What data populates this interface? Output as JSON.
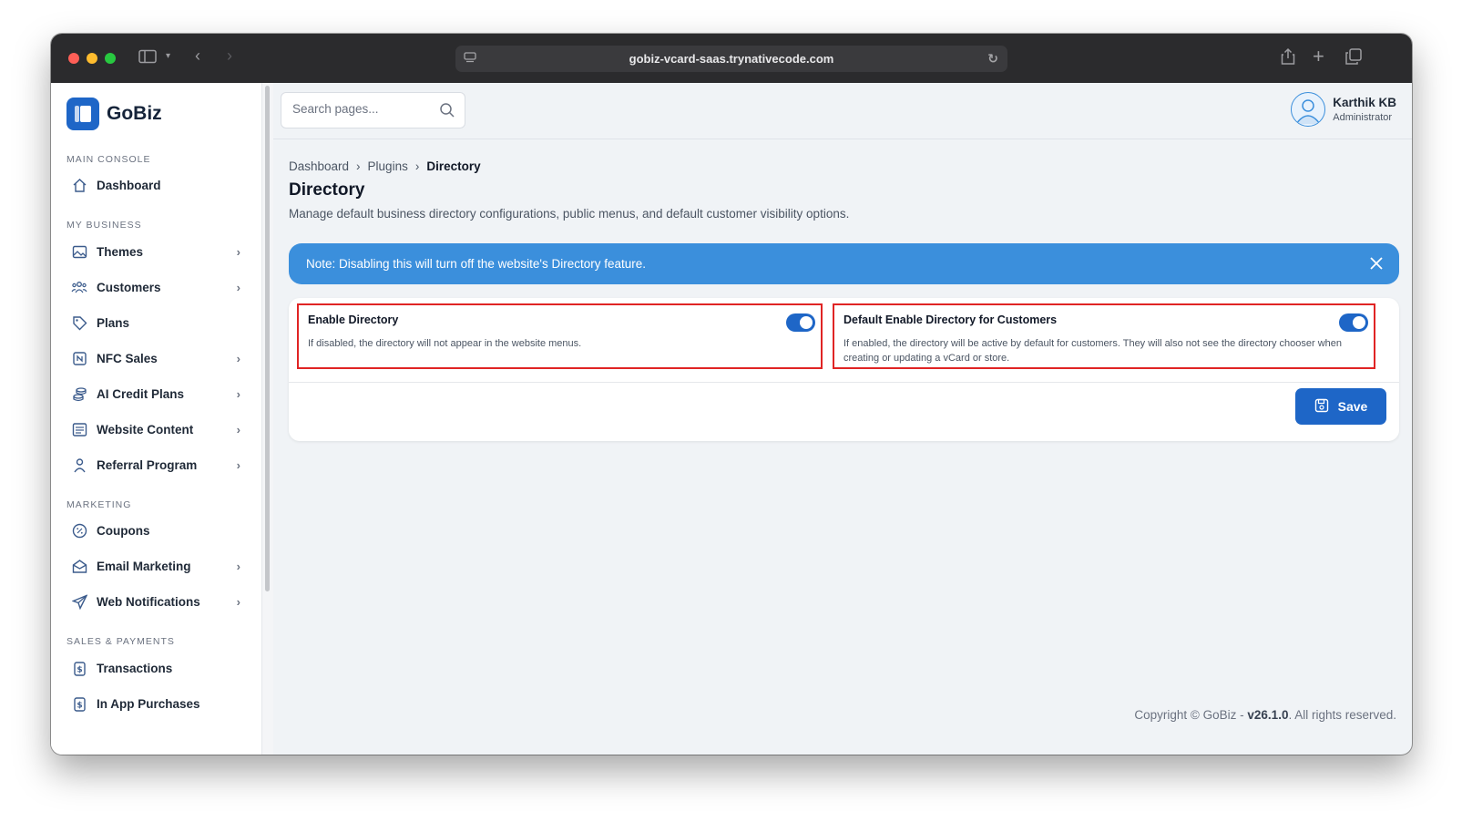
{
  "browser": {
    "url": "gobiz-vcard-saas.trynativecode.com",
    "traffic_light_colors": [
      "#ff5f57",
      "#febc2e",
      "#28c840"
    ]
  },
  "brand": {
    "name": "GoBiz",
    "accent": "#1e66c7"
  },
  "sidebar": {
    "sections": [
      {
        "label": "MAIN CONSOLE",
        "items": [
          {
            "label": "Dashboard",
            "icon": "home-icon",
            "chevron": false
          }
        ]
      },
      {
        "label": "MY BUSINESS",
        "items": [
          {
            "label": "Themes",
            "icon": "image-icon",
            "chevron": true
          },
          {
            "label": "Customers",
            "icon": "users-icon",
            "chevron": true
          },
          {
            "label": "Plans",
            "icon": "tag-icon",
            "chevron": false
          },
          {
            "label": "NFC Sales",
            "icon": "nfc-icon",
            "chevron": true
          },
          {
            "label": "AI Credit Plans",
            "icon": "coins-icon",
            "chevron": true
          },
          {
            "label": "Website Content",
            "icon": "document-icon",
            "chevron": true
          },
          {
            "label": "Referral Program",
            "icon": "user-icon",
            "chevron": true
          }
        ]
      },
      {
        "label": "MARKETING",
        "items": [
          {
            "label": "Coupons",
            "icon": "percent-icon",
            "chevron": false
          },
          {
            "label": "Email Marketing",
            "icon": "mail-icon",
            "chevron": true
          },
          {
            "label": "Web Notifications",
            "icon": "send-icon",
            "chevron": true
          }
        ]
      },
      {
        "label": "SALES & PAYMENTS",
        "items": [
          {
            "label": "Transactions",
            "icon": "receipt-icon",
            "chevron": false
          },
          {
            "label": "In App Purchases",
            "icon": "receipt-icon",
            "chevron": false
          }
        ]
      }
    ]
  },
  "header": {
    "search_placeholder": "Search pages...",
    "user_name": "Karthik KB",
    "user_role": "Administrator"
  },
  "breadcrumb": [
    "Dashboard",
    "Plugins",
    "Directory"
  ],
  "page": {
    "title": "Directory",
    "description": "Manage default business directory configurations, public menus, and default customer visibility options."
  },
  "alert": {
    "text": "Note: Disabling this will turn off the website's Directory feature.",
    "color": "#3b8fdc"
  },
  "settings": [
    {
      "title": "Enable Directory",
      "description": "If disabled, the directory will not appear in the website menus.",
      "enabled": true
    },
    {
      "title": "Default Enable Directory for Customers",
      "description": "If enabled, the directory will be active by default for customers. They will also not see the directory chooser when creating or updating a vCard or store.",
      "enabled": true
    }
  ],
  "actions": {
    "save_label": "Save"
  },
  "footer": {
    "prefix": "Copyright © GoBiz - ",
    "version": "v26.1.0",
    "suffix": ". All rights reserved."
  }
}
